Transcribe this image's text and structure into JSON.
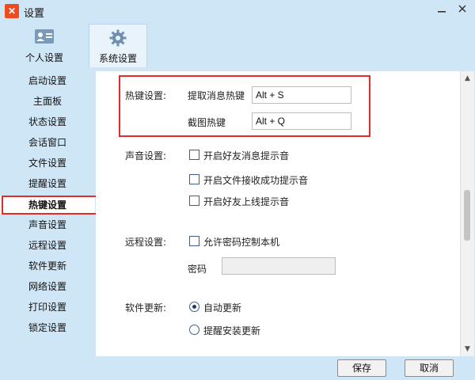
{
  "window": {
    "title": "设置",
    "app_icon_glyph": "✕",
    "minimize_icon": "minimize-icon",
    "close_icon": "close-icon"
  },
  "top_tabs": [
    {
      "label": "个人设置",
      "icon": "profile-card-icon"
    },
    {
      "label": "系统设置",
      "icon": "gear-icon"
    }
  ],
  "sidebar": {
    "items": [
      {
        "label": "启动设置"
      },
      {
        "label": "主面板"
      },
      {
        "label": "状态设置"
      },
      {
        "label": "会话窗口"
      },
      {
        "label": "文件设置"
      },
      {
        "label": "提醒设置"
      },
      {
        "label": "热键设置"
      },
      {
        "label": "声音设置"
      },
      {
        "label": "远程设置"
      },
      {
        "label": "软件更新"
      },
      {
        "label": "网络设置"
      },
      {
        "label": "打印设置"
      },
      {
        "label": "锁定设置"
      }
    ],
    "active_index": 6
  },
  "hotkey": {
    "section_label": "热键设置:",
    "capture_message": {
      "label": "提取消息热键",
      "value": "Alt + S"
    },
    "screenshot": {
      "label": "截图热键",
      "value": "Alt + Q"
    }
  },
  "sound": {
    "section_label": "声音设置:",
    "options": [
      {
        "label": "开启好友消息提示音",
        "checked": false
      },
      {
        "label": "开启文件接收成功提示音",
        "checked": false
      },
      {
        "label": "开启好友上线提示音",
        "checked": false
      }
    ]
  },
  "remote": {
    "section_label": "远程设置:",
    "allow_password": {
      "label": "允许密码控制本机",
      "checked": false
    },
    "password": {
      "label": "密码",
      "value": ""
    }
  },
  "update": {
    "section_label": "软件更新:",
    "options": [
      {
        "label": "自动更新",
        "selected": true
      },
      {
        "label": "提醒安装更新",
        "selected": false
      }
    ]
  },
  "footer": {
    "save_label": "保存",
    "cancel_label": "取消"
  },
  "colors": {
    "chrome": "#cfe6f6",
    "highlight_red": "#e32b2b",
    "app_icon": "#f04a1e"
  }
}
